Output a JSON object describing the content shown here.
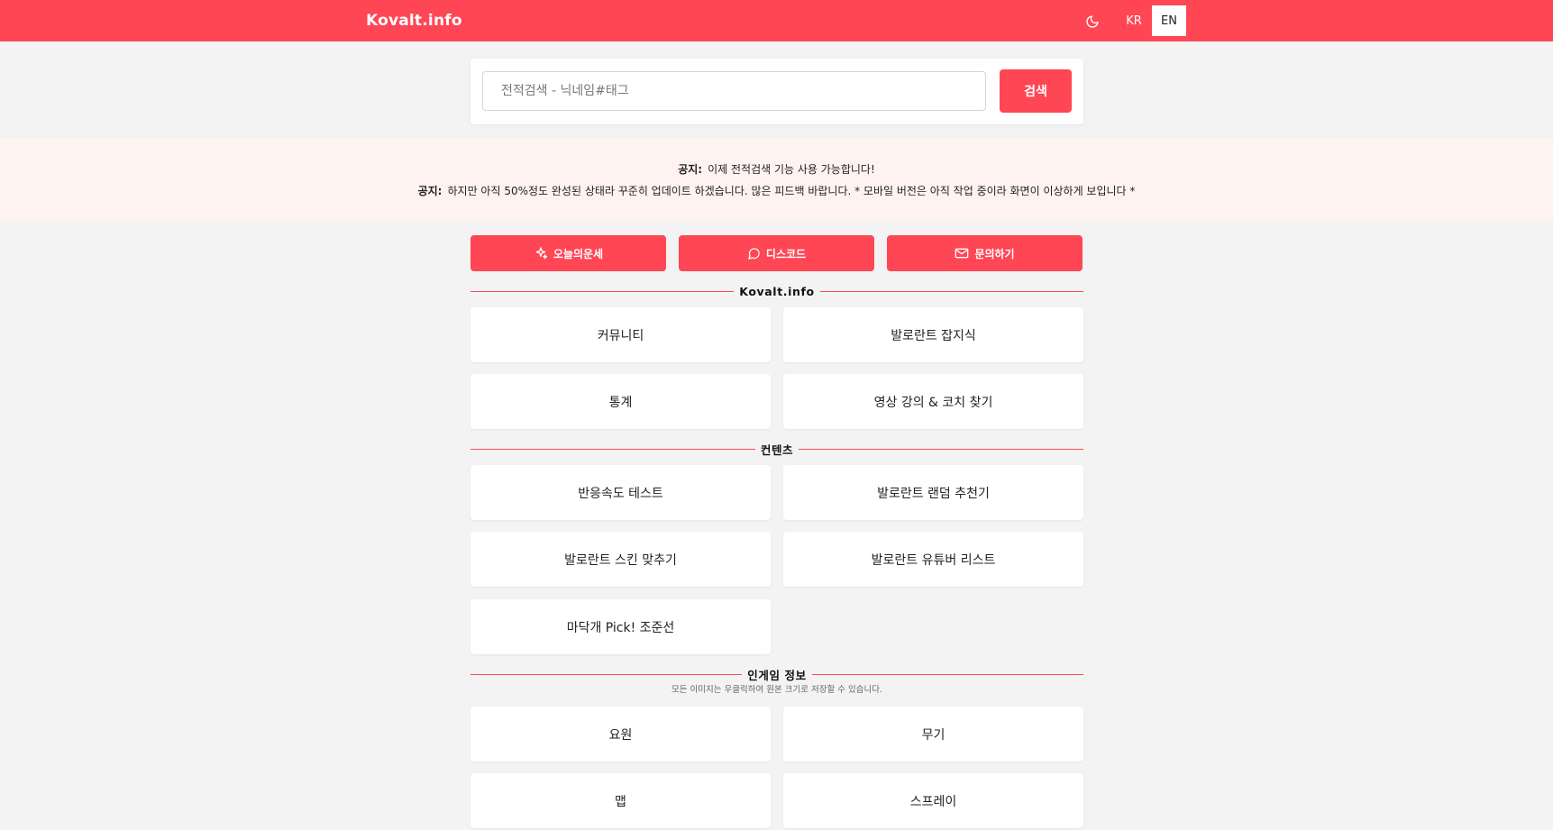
{
  "header": {
    "logo": "Kovalt.info",
    "lang_kr": "KR",
    "lang_en": "EN",
    "theme_icon": "moon-icon"
  },
  "search": {
    "placeholder": "전적검색 - 닉네임#태그",
    "button_label": "검색"
  },
  "notices": [
    {
      "label": "공지:",
      "text": "이제 전적검색 기능 사용 가능합니다!"
    },
    {
      "label": "공지:",
      "text": "하지만 아직 50%정도 완성된 상태라 꾸준히 업데이트 하겠습니다. 많은 피드백 바랍니다. * 모바일 버전은 아직 작업 중이라 화면이 이상하게 보입니다 *"
    }
  ],
  "quick_links": [
    {
      "label": "오늘의운세",
      "icon": "sparkle-icon"
    },
    {
      "label": "디스코드",
      "icon": "chat-bubble-icon"
    },
    {
      "label": "문의하기",
      "icon": "mail-icon"
    }
  ],
  "sections": {
    "site": {
      "title": "Kovalt.info",
      "items": [
        "커뮤니티",
        "발로란트 잡지식",
        "통계",
        "영상 강의 & 코치 찾기"
      ]
    },
    "contents": {
      "title": "컨텐츠",
      "items": [
        "반응속도 테스트",
        "발로란트 랜덤 추천기",
        "발로란트 스킨 맞추기",
        "발로란트 유튜버 리스트",
        "마닥개 Pick! 조준선"
      ]
    },
    "ingame": {
      "title": "인게임 정보",
      "subtitle": "모든 이미지는 우클릭하여 원본 크기로 저장할 수 있습니다.",
      "items": [
        "요원",
        "무기",
        "맵",
        "스프레이"
      ]
    }
  },
  "colors": {
    "accent": "#ff4655",
    "notice_bg": "#fff3f1",
    "page_bg": "#f3f3f3"
  }
}
